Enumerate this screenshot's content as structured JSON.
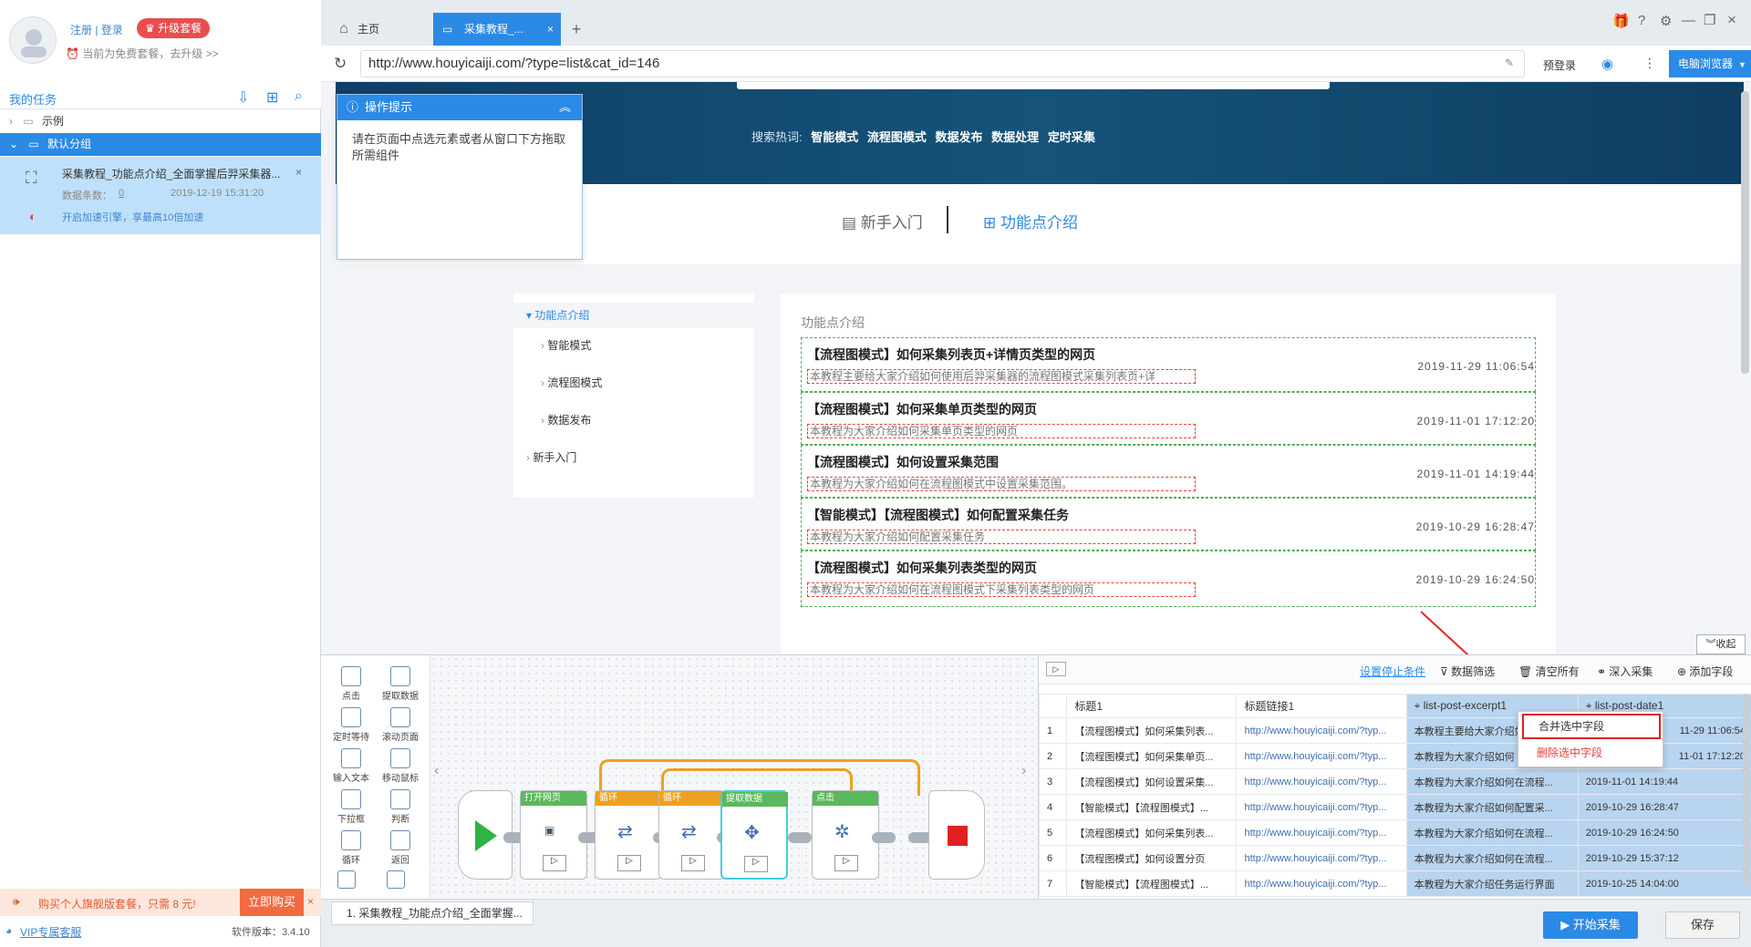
{
  "user": {
    "register_login": "注册 | 登录",
    "upgrade": "升级套餐",
    "plan_hint": "当前为免费套餐，去升级 >>"
  },
  "sidebar": {
    "title": "我的任务",
    "groups": [
      {
        "label": "示例"
      },
      {
        "label": "默认分组"
      }
    ],
    "task": {
      "name": "采集教程_功能点介绍_全面掌握后羿采集器...",
      "count_label": "数据条数：",
      "count": "0",
      "time": "2019-12-19 15:31:20",
      "boost": "开启加速引擎，享最高10倍加速"
    },
    "ad": {
      "text": "购买个人旗舰版套餐，只需 8 元!",
      "buy": "立即购买"
    },
    "vip": "VIP专属客服",
    "version": "软件版本：3.4.10"
  },
  "tabs": [
    {
      "label": "主页"
    },
    {
      "label": "采集教程_..."
    }
  ],
  "address": {
    "url": "http://www.houyicaiji.com/?type=list&cat_id=146",
    "prelogin": "预登录",
    "browser": "电脑浏览器"
  },
  "web": {
    "hot_label": "搜索热词:",
    "hot_words": [
      "智能模式",
      "流程图模式",
      "数据发布",
      "数据处理",
      "定时采集"
    ],
    "tab_newbie": "新手入门",
    "tab_features": "功能点介绍",
    "nav": {
      "root": "功能点介绍",
      "children": [
        "智能模式",
        "流程图模式",
        "数据发布"
      ],
      "other": "新手入门"
    },
    "list_title": "功能点介绍",
    "articles": [
      {
        "title": "【流程图模式】如何采集列表页+详情页类型的网页",
        "excerpt": "本教程主要给大家介绍如何使用后羿采集器的流程图模式采集列表页+详",
        "date": "2019-11-29 11:06:54"
      },
      {
        "title": "【流程图模式】如何采集单页类型的网页",
        "excerpt": "本教程为大家介绍如何采集单页类型的网页",
        "date": "2019-11-01 17:12:20"
      },
      {
        "title": "【流程图模式】如何设置采集范围",
        "excerpt": "本教程为大家介绍如何在流程图模式中设置采集范围。",
        "date": "2019-11-01 14:19:44"
      },
      {
        "title": "【智能模式】【流程图模式】如何配置采集任务",
        "excerpt": "本教程为大家介绍如何配置采集任务",
        "date": "2019-10-29 16:28:47"
      },
      {
        "title": "【流程图模式】如何采集列表类型的网页",
        "excerpt": "本教程为大家介绍如何在流程图模式下采集列表类型的网页",
        "date": "2019-10-29 16:24:50"
      }
    ],
    "collapse": "收起"
  },
  "hint": {
    "title": "操作提示",
    "body": "请在页面中点选元素或者从窗口下方拖取所需组件"
  },
  "toolbox": [
    "点击",
    "提取数据",
    "定时等待",
    "滚动页面",
    "输入文本",
    "移动鼠标",
    "下拉框",
    "判断",
    "循环",
    "返回"
  ],
  "flow": [
    {
      "label": "打开网页",
      "color": "#5cb85c"
    },
    {
      "label": "循环",
      "color": "#f0a020"
    },
    {
      "label": "循环",
      "color": "#f0a020"
    },
    {
      "label": "提取数据",
      "color": "#5cb85c"
    },
    {
      "label": "点击",
      "color": "#5cb85c"
    }
  ],
  "data_toolbar": {
    "stop": "设置停止条件",
    "filter": "数据筛选",
    "clear": "清空所有",
    "deep": "深入采集",
    "add": "添加字段"
  },
  "table": {
    "headers": [
      "标题1",
      "标题链接1",
      "list-post-excerpt1",
      "list-post-date1"
    ],
    "rows": [
      [
        "1",
        "【流程图模式】如何采集列表...",
        "http://www.houyicaiji.com/?typ...",
        "本教程主要给大家介绍如何",
        "11-29 11:06:54"
      ],
      [
        "2",
        "【流程图模式】如何采集单页...",
        "http://www.houyicaiji.com/?typ...",
        "本教程为大家介绍如何",
        "11-01 17:12:20"
      ],
      [
        "3",
        "【流程图模式】如何设置采集...",
        "http://www.houyicaiji.com/?typ...",
        "本教程为大家介绍如何在流程...",
        "2019-11-01 14:19:44"
      ],
      [
        "4",
        "【智能模式】【流程图模式】...",
        "http://www.houyicaiji.com/?typ...",
        "本教程为大家介绍如何配置采...",
        "2019-10-29 16:28:47"
      ],
      [
        "5",
        "【流程图模式】如何采集列表...",
        "http://www.houyicaiji.com/?typ...",
        "本教程为大家介绍如何在流程...",
        "2019-10-29 16:24:50"
      ],
      [
        "6",
        "【流程图模式】如何设置分页",
        "http://www.houyicaiji.com/?typ...",
        "本教程为大家介绍如何在流程...",
        "2019-10-29 15:37:12"
      ],
      [
        "7",
        "【智能模式】【流程图模式】...",
        "http://www.houyicaiji.com/?typ...",
        "本教程为大家介绍任务运行界面",
        "2019-10-25 14:04:00"
      ]
    ]
  },
  "context_menu": {
    "merge": "合并选中字段",
    "delete": "删除选中字段"
  },
  "bottom": {
    "task_tab": "1. 采集教程_功能点介绍_全面掌握...",
    "start": "开始采集",
    "save": "保存"
  },
  "colors": {
    "accent": "#2b8ae6",
    "danger": "#e8413c",
    "selected": "#b9d4ef"
  }
}
